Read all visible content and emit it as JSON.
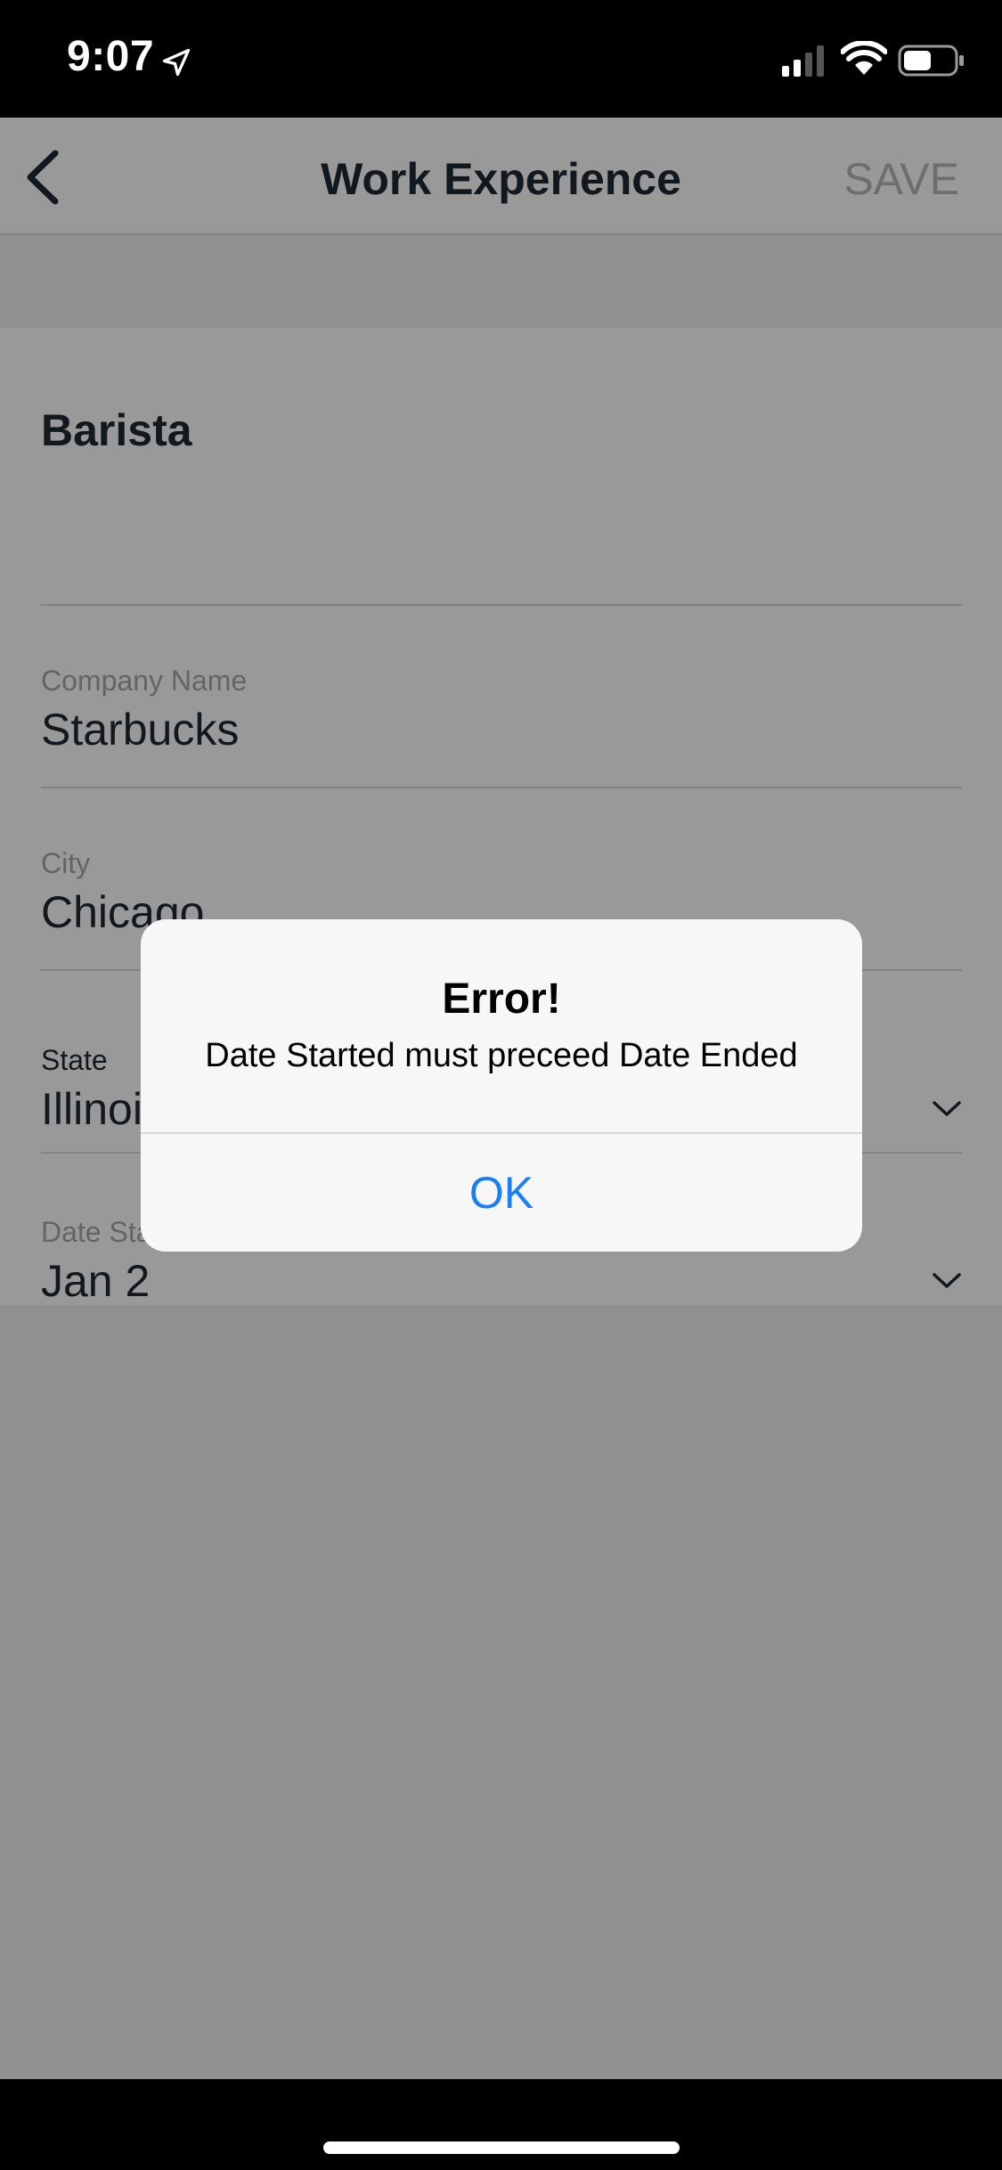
{
  "status_bar": {
    "time": "9:07",
    "icons": [
      "location-arrow-icon",
      "cellular-signal-icon",
      "wifi-icon",
      "battery-icon"
    ]
  },
  "nav": {
    "title": "Work Experience",
    "save_label": "SAVE",
    "back_icon": "chevron-left-icon"
  },
  "form": {
    "job_title": "Barista",
    "company": {
      "label": "Company Name",
      "value": "Starbucks"
    },
    "city": {
      "label": "City",
      "value": "Chicago"
    },
    "state": {
      "label": "State",
      "value": "Illinois"
    },
    "date_started": {
      "label": "Date Started",
      "value": "Jan 2"
    }
  },
  "alert": {
    "title": "Error!",
    "message": "Date Started must preceed Date Ended",
    "ok_label": "OK"
  },
  "colors": {
    "accent_blue": "#1a7ef5",
    "text_dark": "#1f2a33",
    "label_gray": "#a7a7a7",
    "save_disabled": "#b7b7b7"
  }
}
